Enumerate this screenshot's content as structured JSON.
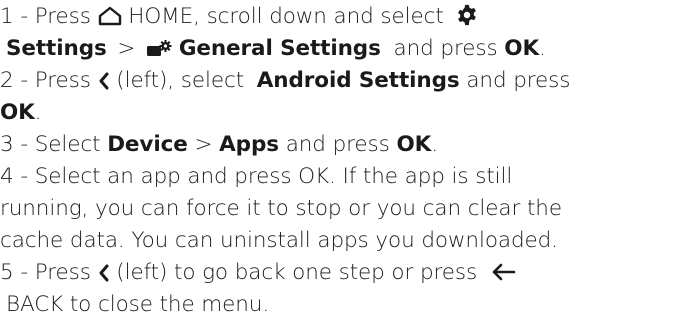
{
  "steps": {
    "s1": {
      "num": "1 - ",
      "press": "Press",
      "home_label": "HOME, scroll down and select",
      "settings": "Settings",
      "sep1": ">",
      "general_settings": "General Settings",
      "and_press": "and press",
      "ok": "OK",
      "end": "."
    },
    "s2": {
      "num": "2 - ",
      "press": "Press",
      "left_text": "(left), select",
      "android_settings": "Android Settings",
      "and_press": "and press",
      "ok": "OK",
      "end": "."
    },
    "s3": {
      "num": "3 - ",
      "select": "Select",
      "device": "Device",
      "sep": ">",
      "apps": "Apps",
      "and_press": "and press",
      "ok": "OK",
      "end": "."
    },
    "s4": {
      "line1": "4 -  Select an app and press OK. If the app is still",
      "line2": "running, you can force it to stop or you can clear the",
      "line3": "cache data. You can uninstall apps you downloaded."
    },
    "s5": {
      "num": "5 - ",
      "press": "Press",
      "left_text": "(left) to go back one step or press",
      "back_text": "BACK to close the menu."
    }
  },
  "icons": {
    "home": "home-icon",
    "settings": "gear-icon",
    "general_settings": "tv-settings-icon",
    "left": "chevron-left-icon",
    "back": "arrow-left-icon"
  }
}
